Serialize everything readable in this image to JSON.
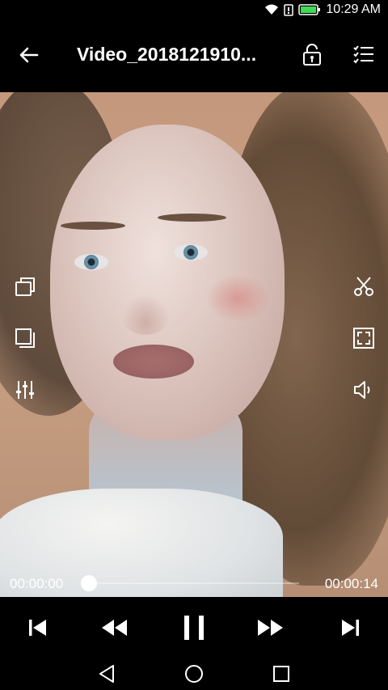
{
  "status_bar": {
    "time": "10:29 AM",
    "icons": [
      "wifi-icon",
      "alarm-icon",
      "battery-icon"
    ]
  },
  "app_bar": {
    "title": "Video_2018121910...",
    "back_icon": "back-arrow-icon",
    "lock_icon": "screen-lock-icon",
    "list_icon": "playlist-icon"
  },
  "player": {
    "left_tools": [
      "rotate-icon",
      "aspect-ratio-icon",
      "equalizer-icon"
    ],
    "right_tools": [
      "scissors-icon",
      "fullscreen-icon",
      "volume-icon"
    ],
    "progress": {
      "current_time": "00:00:00",
      "total_time": "00:00:14",
      "played_fraction": 0.0
    },
    "controls": [
      "skip-previous-icon",
      "rewind-icon",
      "pause-icon",
      "fast-forward-icon",
      "skip-next-icon"
    ]
  },
  "nav_bar": {
    "buttons": [
      "back-triangle-icon",
      "home-circle-icon",
      "recents-square-icon"
    ]
  }
}
